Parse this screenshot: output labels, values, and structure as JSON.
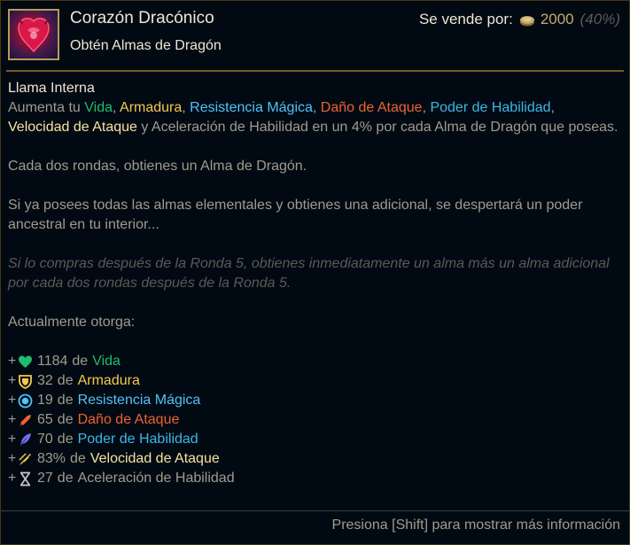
{
  "item": {
    "name": "Corazón Dracónico",
    "subtitle": "Obtén Almas de Dragón",
    "icon": "dragon-heart-icon"
  },
  "sell": {
    "label": "Se vende por:",
    "price": "2000",
    "percent": "(40%)",
    "icon": "gold-coin-icon"
  },
  "passive": {
    "name": "Llama Interna",
    "desc": {
      "prefix": "Aumenta tu ",
      "vida": "Vida",
      "sep1": ", ",
      "armadura": "Armadura",
      "sep2": ", ",
      "resistencia": "Resistencia Mágica",
      "sep3": ", ",
      "dano": "Daño de Ataque",
      "sep4": ", ",
      "poder": "Poder de Habilidad",
      "sep5": ",",
      "velocidad": "Velocidad de Ataque",
      "suffix": " y Aceleración de Habilidad en un 4% por cada Alma de Dragón que poseas."
    },
    "para2": "Cada dos rondas, obtienes un Alma de Dragón.",
    "para3": "Si ya posees todas las almas elementales y obtienes una adicional, se despertará un poder ancestral en tu interior...",
    "para4": "Si lo compras después de la Ronda 5, obtienes inmediatamente un alma más un alma adicional por cada dos rondas después de la Ronda 5.",
    "current_label": "Actualmente otorga:"
  },
  "stats": [
    {
      "plus": "+",
      "icon": "heart-icon",
      "value": "1184",
      "de": "de",
      "name": "Vida",
      "color": "#1cbd6b"
    },
    {
      "plus": "+",
      "icon": "shield-icon",
      "value": "32",
      "de": "de",
      "name": "Armadura",
      "color": "#f2c94c"
    },
    {
      "plus": "+",
      "icon": "magic-resist-icon",
      "value": "19",
      "de": "de",
      "name": "Resistencia Mágica",
      "color": "#4fc3f7"
    },
    {
      "plus": "+",
      "icon": "sword-icon",
      "value": "65",
      "de": "de",
      "name": "Daño de Ataque",
      "color": "#ee6232"
    },
    {
      "plus": "+",
      "icon": "feather-icon",
      "value": "70",
      "de": "de",
      "name": "Poder de Habilidad",
      "color": "#3fb7e6"
    },
    {
      "plus": "+",
      "icon": "attack-speed-icon",
      "value": "83%",
      "de": "de",
      "name": "Velocidad de Ataque",
      "color": "#f7e2a0"
    },
    {
      "plus": "+",
      "icon": "hourglass-icon",
      "value": "27",
      "de": "de",
      "name": "Aceleración de Habilidad",
      "color": "#a09b8c"
    }
  ],
  "footer": "Presiona [Shift] para mostrar más información",
  "colors": {
    "border": "#463714",
    "gold": "#c8aa6e",
    "background": "#010a13"
  }
}
